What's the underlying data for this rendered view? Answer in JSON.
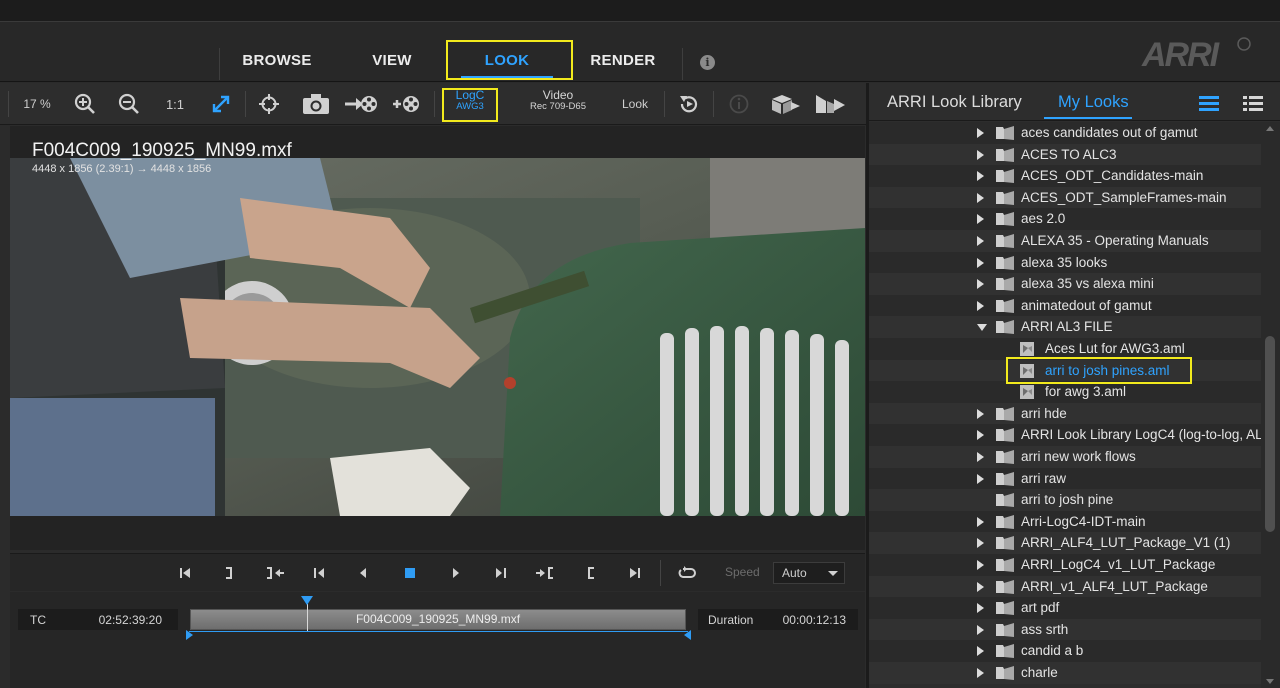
{
  "nav": {
    "tabs": [
      {
        "label": "BROWSE",
        "active": false
      },
      {
        "label": "VIEW",
        "active": false
      },
      {
        "label": "LOOK",
        "active": true
      },
      {
        "label": "RENDER",
        "active": false
      }
    ],
    "info_icon": "info-icon",
    "logo_text": "ARRI"
  },
  "toolbar": {
    "zoom_level": "17 %",
    "ratio_label": "1:1",
    "colorspace": {
      "line1": "LogC",
      "line2": "AWG3"
    },
    "video": {
      "line1": "Video",
      "line2": "Rec 709-D65"
    },
    "look_label": "Look"
  },
  "viewer": {
    "clip_name": "F004C009_190925_MN99.mxf",
    "resolution": "4448 x 1856 (2.39:1) → 4448 x 1856"
  },
  "transport": {
    "speed_label": "Speed",
    "speed_value": "Auto"
  },
  "timeline": {
    "tc_label": "TC",
    "tc_value": "02:52:39:20",
    "clip_name": "F004C009_190925_MN99.mxf",
    "duration_label": "Duration",
    "duration_value": "00:00:12:13"
  },
  "panel": {
    "tabs": [
      {
        "label": "ARRI Look Library",
        "active": false
      },
      {
        "label": "My Looks",
        "active": true
      }
    ],
    "tree": [
      {
        "name": "aces candidates out of gamut",
        "type": "folder",
        "expandable": true,
        "expanded": false,
        "level": 0
      },
      {
        "name": "ACES TO ALC3",
        "type": "folder",
        "expandable": true,
        "expanded": false,
        "level": 0
      },
      {
        "name": "ACES_ODT_Candidates-main",
        "type": "folder",
        "expandable": true,
        "expanded": false,
        "level": 0
      },
      {
        "name": "ACES_ODT_SampleFrames-main",
        "type": "folder",
        "expandable": true,
        "expanded": false,
        "level": 0
      },
      {
        "name": "aes 2.0",
        "type": "folder",
        "expandable": true,
        "expanded": false,
        "level": 0
      },
      {
        "name": "ALEXA 35 - Operating Manuals",
        "type": "folder",
        "expandable": true,
        "expanded": false,
        "level": 0
      },
      {
        "name": "alexa 35 looks",
        "type": "folder",
        "expandable": true,
        "expanded": false,
        "level": 0
      },
      {
        "name": "alexa 35 vs alexa mini",
        "type": "folder",
        "expandable": true,
        "expanded": false,
        "level": 0
      },
      {
        "name": "animatedout of gamut",
        "type": "folder",
        "expandable": true,
        "expanded": false,
        "level": 0
      },
      {
        "name": "ARRI AL3 FILE",
        "type": "folder",
        "expandable": true,
        "expanded": true,
        "level": 0
      },
      {
        "name": "Aces Lut for AWG3.aml",
        "type": "file",
        "expandable": false,
        "level": 1
      },
      {
        "name": "arri to josh pines.aml",
        "type": "file",
        "expandable": false,
        "level": 1,
        "selected": true
      },
      {
        "name": "for awg 3.aml",
        "type": "file",
        "expandable": false,
        "level": 1
      },
      {
        "name": "arri hde",
        "type": "folder",
        "expandable": true,
        "expanded": false,
        "level": 0
      },
      {
        "name": "ARRI Look Library LogC4 (log-to-log, AL",
        "type": "folder",
        "expandable": true,
        "expanded": false,
        "level": 0
      },
      {
        "name": "arri new work flows",
        "type": "folder",
        "expandable": true,
        "expanded": false,
        "level": 0
      },
      {
        "name": "arri raw",
        "type": "folder",
        "expandable": true,
        "expanded": false,
        "level": 0
      },
      {
        "name": "arri to josh pine",
        "type": "folder",
        "expandable": false,
        "expanded": false,
        "level": 0
      },
      {
        "name": "Arri-LogC4-IDT-main",
        "type": "folder",
        "expandable": true,
        "expanded": false,
        "level": 0
      },
      {
        "name": "ARRI_ALF4_LUT_Package_V1 (1)",
        "type": "folder",
        "expandable": true,
        "expanded": false,
        "level": 0
      },
      {
        "name": "ARRI_LogC4_v1_LUT_Package",
        "type": "folder",
        "expandable": true,
        "expanded": false,
        "level": 0
      },
      {
        "name": "ARRI_v1_ALF4_LUT_Package",
        "type": "folder",
        "expandable": true,
        "expanded": false,
        "level": 0
      },
      {
        "name": "art pdf",
        "type": "folder",
        "expandable": true,
        "expanded": false,
        "level": 0
      },
      {
        "name": "ass srth",
        "type": "folder",
        "expandable": true,
        "expanded": false,
        "level": 0
      },
      {
        "name": "candid a b",
        "type": "folder",
        "expandable": true,
        "expanded": false,
        "level": 0
      },
      {
        "name": "charle",
        "type": "folder",
        "expandable": true,
        "expanded": false,
        "level": 0
      }
    ]
  },
  "colors": {
    "accent": "#2fa3ff",
    "highlight": "#f2ea1d",
    "background": "#2b2b2b"
  }
}
